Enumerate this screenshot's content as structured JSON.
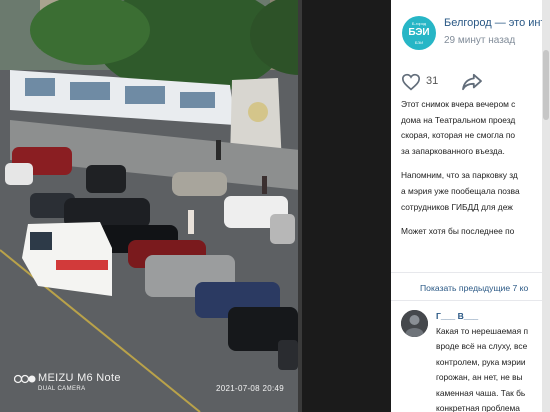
{
  "photo": {
    "camera_brand": "MEIZU M6 Note",
    "camera_sub": "DUAL CAMERA",
    "timestamp": "2021-07-08  20:49"
  },
  "group": {
    "logo_top": "Б-город",
    "logo_main": "БЭИ",
    "logo_bottom": "БЭИ",
    "name": "Белгород — это интер",
    "time": "29 минут назад"
  },
  "actions": {
    "likes": "31",
    "like_icon": "heart-outline-icon",
    "share_icon": "share-arrow-icon"
  },
  "post": {
    "lines_1": [
      "Этот снимок вчера вечером с",
      "дома на Театральном проезд",
      "скорая, которая не смогла по",
      "за запаркованного въезда."
    ],
    "lines_2": [
      "Напомним, что за парковку зд",
      "а мэрия уже пообещала позва",
      "сотрудников ГИБДД для деж"
    ],
    "lines_3": [
      "Может хотя бы последнее по"
    ]
  },
  "comments": {
    "show_previous": "Показать предыдущие 7 ко",
    "author": "Г___ В___",
    "text_lines": [
      "Какая то нерешаемая п",
      "вроде всё на слуху, все",
      "контролем, рука мэрии",
      "горожан, ан нет, не вы",
      "каменная чаша. Так бь",
      "конкретная проблема"
    ]
  },
  "colors": {
    "link": "#2a5885",
    "accent": "#27b6c6",
    "muted": "#818c99"
  }
}
